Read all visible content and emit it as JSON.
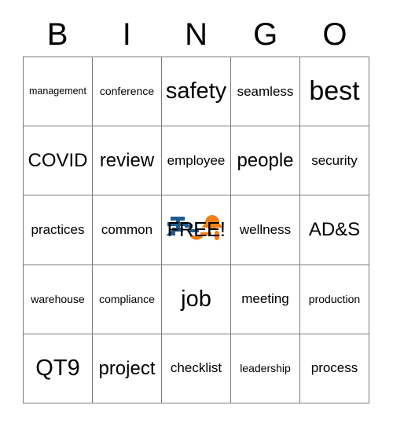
{
  "card": {
    "header": {
      "letters": [
        "B",
        "I",
        "N",
        "G",
        "O"
      ]
    },
    "grid": {
      "rows": [
        [
          {
            "text": "management",
            "size": "xxs"
          },
          {
            "text": "conference",
            "size": "xs"
          },
          {
            "text": "safety",
            "size": "lg"
          },
          {
            "text": "seamless",
            "size": "sm"
          },
          {
            "text": "best",
            "size": "xl"
          }
        ],
        [
          {
            "text": "COVID",
            "size": "md"
          },
          {
            "text": "review",
            "size": "md"
          },
          {
            "text": "employee",
            "size": "sm"
          },
          {
            "text": "people",
            "size": "md"
          },
          {
            "text": "security",
            "size": "sm"
          }
        ],
        [
          {
            "text": "practices",
            "size": "sm"
          },
          {
            "text": "common",
            "size": "sm"
          },
          {
            "text": "FREE!",
            "size": "free"
          },
          {
            "text": "wellness",
            "size": "sm"
          },
          {
            "text": "AD&S",
            "size": "md"
          }
        ],
        [
          {
            "text": "warehouse",
            "size": "xs"
          },
          {
            "text": "compliance",
            "size": "xs"
          },
          {
            "text": "job",
            "size": "lg"
          },
          {
            "text": "meeting",
            "size": "sm"
          },
          {
            "text": "production",
            "size": "xs"
          }
        ],
        [
          {
            "text": "QT9",
            "size": "lg"
          },
          {
            "text": "project",
            "size": "md"
          },
          {
            "text": "checklist",
            "size": "sm"
          },
          {
            "text": "leadership",
            "size": "xs"
          },
          {
            "text": "process",
            "size": "sm"
          }
        ]
      ]
    },
    "free_space": {
      "label": "FREE!",
      "logo_name": "qt9-logo",
      "logo_colors": {
        "blue": "#1F5C8B",
        "orange": "#F0801A"
      }
    },
    "colors": {
      "grid_line": "#7a7a7a",
      "text": "#000000",
      "background": "#ffffff"
    }
  }
}
